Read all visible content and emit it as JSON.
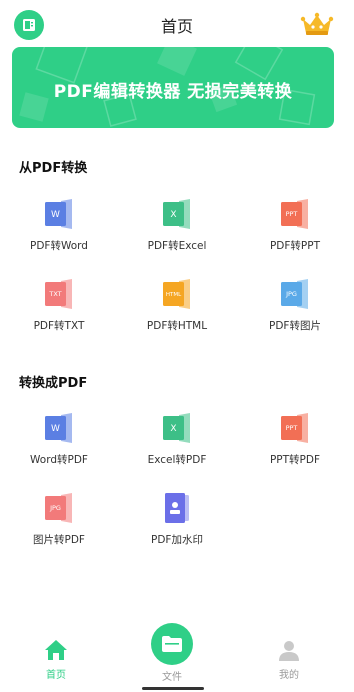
{
  "header": {
    "title": "首页"
  },
  "banner": {
    "text": "PDF编辑转换器   无损完美转换"
  },
  "from_pdf": {
    "title": "从PDF转换",
    "items": [
      {
        "label": "PDF转Word",
        "icon": "word-icon",
        "color": "#5b7fe3",
        "tag": "W"
      },
      {
        "label": "PDF转Excel",
        "icon": "excel-icon",
        "color": "#3dbf87",
        "tag": "X"
      },
      {
        "label": "PDF转PPT",
        "icon": "ppt-icon",
        "color": "#f26f55",
        "tag": "PPT"
      },
      {
        "label": "PDF转TXT",
        "icon": "txt-icon",
        "color": "#f27a7a",
        "tag": "TXT"
      },
      {
        "label": "PDF转HTML",
        "icon": "html-icon",
        "color": "#f5a623",
        "tag": "HTML"
      },
      {
        "label": "PDF转图片",
        "icon": "jpg-icon",
        "color": "#5aa9e8",
        "tag": "JPG"
      }
    ]
  },
  "to_pdf": {
    "title": "转换成PDF",
    "items": [
      {
        "label": "Word转PDF",
        "icon": "word-icon",
        "color": "#5b7fe3",
        "tag": "W"
      },
      {
        "label": "Excel转PDF",
        "icon": "excel-icon",
        "color": "#3dbf87",
        "tag": "X"
      },
      {
        "label": "PPT转PDF",
        "icon": "ppt-icon",
        "color": "#f26f55",
        "tag": "PPT"
      },
      {
        "label": "图片转PDF",
        "icon": "jpg-icon",
        "color": "#f27a7a",
        "tag": "JPG"
      },
      {
        "label": "PDF加水印",
        "icon": "watermark-icon",
        "color": "#6b6fe8",
        "tag": ""
      }
    ]
  },
  "nav": {
    "home": "首页",
    "files": "文件",
    "mine": "我的"
  },
  "colors": {
    "accent": "#2fcf87",
    "inactive": "#9a9a9a"
  }
}
